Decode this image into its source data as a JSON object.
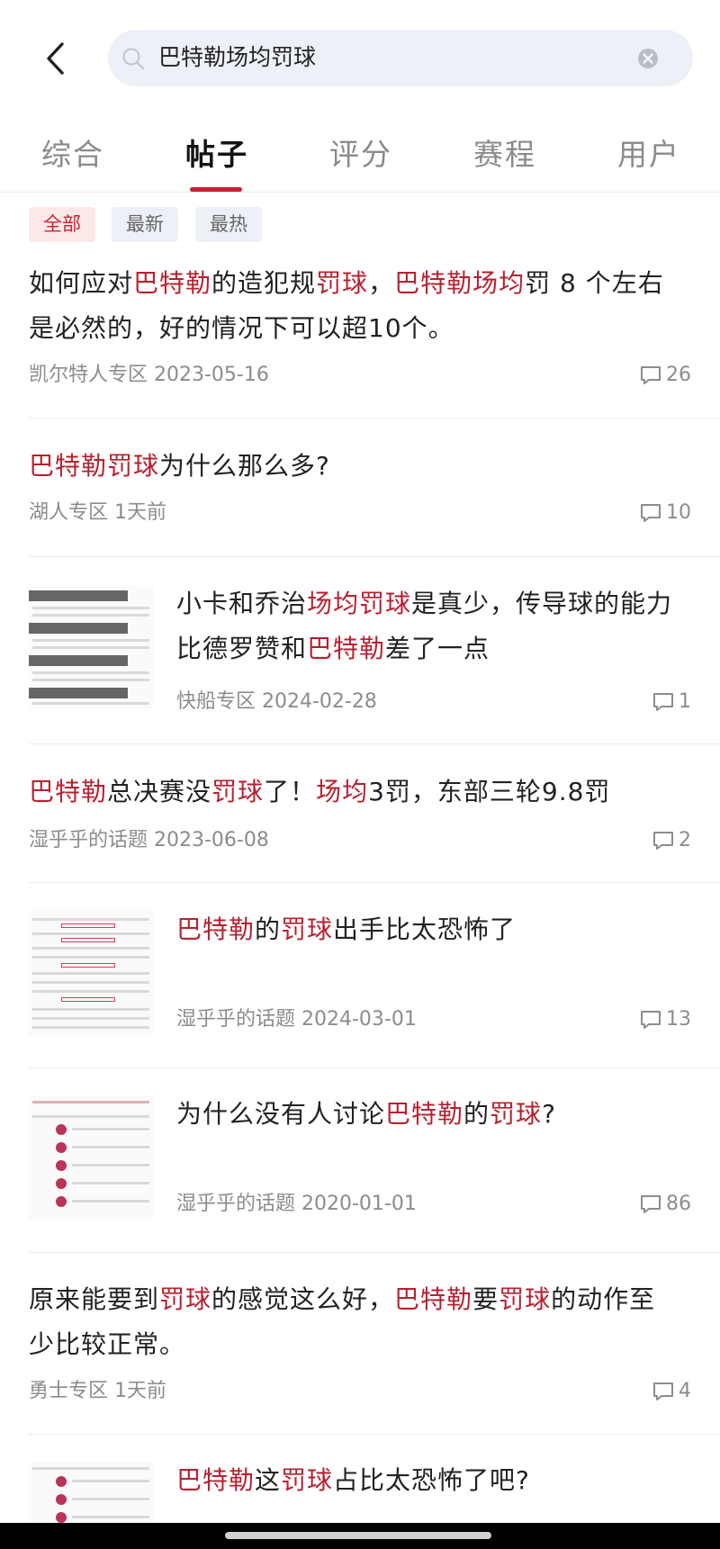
{
  "search": {
    "query": "巴特勒场均罚球"
  },
  "tabs": [
    {
      "label": "综合",
      "active": false
    },
    {
      "label": "帖子",
      "active": true
    },
    {
      "label": "评分",
      "active": false
    },
    {
      "label": "赛程",
      "active": false
    },
    {
      "label": "用户",
      "active": false
    }
  ],
  "filters": [
    {
      "label": "全部",
      "active": true
    },
    {
      "label": "最新",
      "active": false
    },
    {
      "label": "最热",
      "active": false
    }
  ],
  "posts": [
    {
      "title": [
        {
          "t": "如何应对"
        },
        {
          "t": "巴特勒",
          "hl": true
        },
        {
          "t": "的造犯规"
        },
        {
          "t": "罚球",
          "hl": true
        },
        {
          "t": "，"
        },
        {
          "t": "巴特勒场均",
          "hl": true
        },
        {
          "t": "罚 8 个左右是必然的，好的情况下可以超10个。"
        }
      ],
      "meta": "凯尔特人专区 2023-05-16",
      "comments": "26"
    },
    {
      "title": [
        {
          "t": "巴特勒罚球",
          "hl": true
        },
        {
          "t": "为什么那么多?"
        }
      ],
      "meta": "湖人专区 1天前",
      "comments": "10"
    },
    {
      "title": [
        {
          "t": "小卡和乔治"
        },
        {
          "t": "场均罚球",
          "hl": true
        },
        {
          "t": "是真少，传导球的能力比德罗赞和"
        },
        {
          "t": "巴特勒",
          "hl": true
        },
        {
          "t": "差了一点"
        }
      ],
      "meta": "快船专区 2024-02-28",
      "comments": "1"
    },
    {
      "title": [
        {
          "t": "巴特勒",
          "hl": true
        },
        {
          "t": "总决赛没"
        },
        {
          "t": "罚球",
          "hl": true
        },
        {
          "t": "了！"
        },
        {
          "t": "场均",
          "hl": true
        },
        {
          "t": "3罚，东部三轮9.8罚"
        }
      ],
      "meta": "湿乎乎的话题 2023-06-08",
      "comments": "2"
    },
    {
      "title": [
        {
          "t": "巴特勒",
          "hl": true
        },
        {
          "t": "的"
        },
        {
          "t": "罚球",
          "hl": true
        },
        {
          "t": "出手比太恐怖了"
        }
      ],
      "meta": "湿乎乎的话题 2024-03-01",
      "comments": "13"
    },
    {
      "title": [
        {
          "t": "为什么没有人讨论"
        },
        {
          "t": "巴特勒",
          "hl": true
        },
        {
          "t": "的"
        },
        {
          "t": "罚球",
          "hl": true
        },
        {
          "t": "?"
        }
      ],
      "meta": "湿乎乎的话题 2020-01-01",
      "comments": "86"
    },
    {
      "title": [
        {
          "t": "原来能要到"
        },
        {
          "t": "罚球",
          "hl": true
        },
        {
          "t": "的感觉这么好，"
        },
        {
          "t": "巴特勒",
          "hl": true
        },
        {
          "t": "要"
        },
        {
          "t": "罚球",
          "hl": true
        },
        {
          "t": "的动作至少比较正常。"
        }
      ],
      "meta": "勇士专区 1天前",
      "comments": "4"
    },
    {
      "title": [
        {
          "t": "巴特勒",
          "hl": true
        },
        {
          "t": "这"
        },
        {
          "t": "罚球",
          "hl": true
        },
        {
          "t": "占比太恐怖了吧?"
        }
      ],
      "meta": "",
      "comments": ""
    }
  ],
  "colors": {
    "accent": "#b8202f",
    "tab_underline": "#c8202f",
    "search_bg": "#eef0f8",
    "chip_active_bg": "#fde8e8",
    "meta_text": "#8c8c8c"
  },
  "icons": {
    "back": "chevron-left-icon",
    "search": "search-icon",
    "clear": "clear-icon",
    "comment": "comment-icon"
  }
}
